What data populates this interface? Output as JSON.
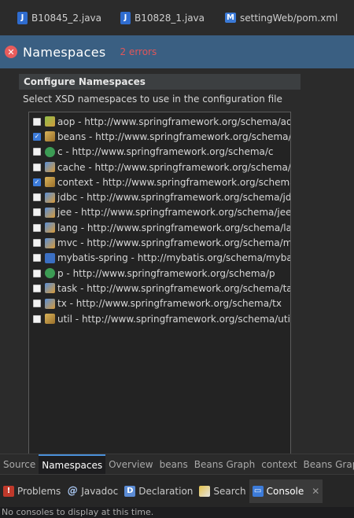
{
  "editor_tabs": [
    {
      "label": "B10845_2.java",
      "icon": "java-file-icon"
    },
    {
      "label": "B10828_1.java",
      "icon": "java-file-icon"
    },
    {
      "label": "settingWeb/pom.xml",
      "icon": "maven-pom-icon"
    }
  ],
  "form": {
    "title": "Namespaces",
    "errors": "2 errors"
  },
  "section": {
    "title": "Configure Namespaces",
    "description": "Select XSD namespaces to use in the configuration file"
  },
  "namespaces": [
    {
      "label": "aop - http://www.springframework.org/schema/aop",
      "checked": false,
      "icon": "leaf"
    },
    {
      "label": "beans - http://www.springframework.org/schema/beans",
      "checked": true,
      "icon": "spring"
    },
    {
      "label": "c - http://www.springframework.org/schema/c",
      "checked": false,
      "icon": "green"
    },
    {
      "label": "cache - http://www.springframework.org/schema/cache",
      "checked": false,
      "icon": "blue"
    },
    {
      "label": "context - http://www.springframework.org/schema/context",
      "checked": true,
      "icon": "spring"
    },
    {
      "label": "jdbc - http://www.springframework.org/schema/jdbc",
      "checked": false,
      "icon": "blue"
    },
    {
      "label": "jee - http://www.springframework.org/schema/jee",
      "checked": false,
      "icon": "blue"
    },
    {
      "label": "lang - http://www.springframework.org/schema/lang",
      "checked": false,
      "icon": "blue"
    },
    {
      "label": "mvc - http://www.springframework.org/schema/mvc",
      "checked": false,
      "icon": "blue"
    },
    {
      "label": "mybatis-spring - http://mybatis.org/schema/mybatis-spring",
      "checked": false,
      "icon": "mb"
    },
    {
      "label": "p - http://www.springframework.org/schema/p",
      "checked": false,
      "icon": "green"
    },
    {
      "label": "task - http://www.springframework.org/schema/task",
      "checked": false,
      "icon": "blue"
    },
    {
      "label": "tx - http://www.springframework.org/schema/tx",
      "checked": false,
      "icon": "blue"
    },
    {
      "label": "util - http://www.springframework.org/schema/util",
      "checked": false,
      "icon": "spring"
    }
  ],
  "page_tabs": [
    "Source",
    "Namespaces",
    "Overview",
    "beans",
    "Beans Graph",
    "context",
    "Beans Graph"
  ],
  "active_page_tab": "Namespaces",
  "views": [
    {
      "label": "Problems",
      "icon": "problems-icon"
    },
    {
      "label": "Javadoc",
      "icon": "javadoc-icon"
    },
    {
      "label": "Declaration",
      "icon": "declaration-icon"
    },
    {
      "label": "Search",
      "icon": "search-icon"
    },
    {
      "label": "Console",
      "icon": "console-icon",
      "close": "✕"
    }
  ],
  "status_message": "No consoles to display at this time."
}
